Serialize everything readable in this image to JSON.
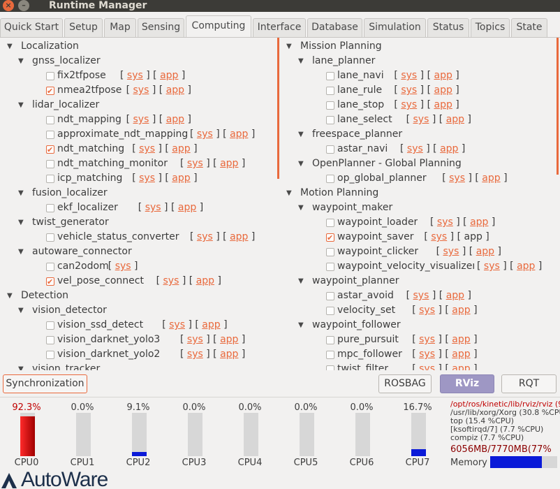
{
  "window": {
    "title": "Runtime Manager"
  },
  "tabs": [
    "Quick Start",
    "Setup",
    "Map",
    "Sensing",
    "Computing",
    "Interface",
    "Database",
    "Simulation",
    "Status",
    "Topics",
    "State"
  ],
  "active_tab": "Computing",
  "left_tree": [
    {
      "type": "group",
      "level": 0,
      "label": "Localization"
    },
    {
      "type": "group",
      "level": 1,
      "label": "gnss_localizer"
    },
    {
      "type": "node",
      "label": "fix2tfpose",
      "checked": false
    },
    {
      "type": "node",
      "label": "nmea2tfpose",
      "checked": true
    },
    {
      "type": "group",
      "level": 1,
      "label": "lidar_localizer"
    },
    {
      "type": "node",
      "label": "ndt_mapping",
      "checked": false
    },
    {
      "type": "node",
      "label": "approximate_ndt_mapping",
      "checked": false
    },
    {
      "type": "node",
      "label": "ndt_matching",
      "checked": true
    },
    {
      "type": "node",
      "label": "ndt_matching_monitor",
      "checked": false
    },
    {
      "type": "node",
      "label": "icp_matching",
      "checked": false
    },
    {
      "type": "group",
      "level": 1,
      "label": "fusion_localizer"
    },
    {
      "type": "node",
      "label": "ekf_localizer",
      "checked": false
    },
    {
      "type": "group",
      "level": 1,
      "label": "twist_generator"
    },
    {
      "type": "node",
      "label": "vehicle_status_converter",
      "checked": false
    },
    {
      "type": "group",
      "level": 1,
      "label": "autoware_connector"
    },
    {
      "type": "node",
      "label": "can2odom",
      "checked": false,
      "app": false
    },
    {
      "type": "node",
      "label": "vel_pose_connect",
      "checked": true
    },
    {
      "type": "group",
      "level": 0,
      "label": "Detection"
    },
    {
      "type": "group",
      "level": 1,
      "label": "vision_detector"
    },
    {
      "type": "node",
      "label": "vision_ssd_detect",
      "checked": false
    },
    {
      "type": "node",
      "label": "vision_darknet_yolo3",
      "checked": false
    },
    {
      "type": "node",
      "label": "vision_darknet_yolo2",
      "checked": false
    },
    {
      "type": "group",
      "level": 1,
      "label": "vision_tracker"
    }
  ],
  "right_tree": [
    {
      "type": "group",
      "level": 0,
      "label": "Mission Planning"
    },
    {
      "type": "group",
      "level": 1,
      "label": "lane_planner"
    },
    {
      "type": "node",
      "label": "lane_navi",
      "checked": false
    },
    {
      "type": "node",
      "label": "lane_rule",
      "checked": false
    },
    {
      "type": "node",
      "label": "lane_stop",
      "checked": false
    },
    {
      "type": "node",
      "label": "lane_select",
      "checked": false
    },
    {
      "type": "group",
      "level": 1,
      "label": "freespace_planner"
    },
    {
      "type": "node",
      "label": "astar_navi",
      "checked": false
    },
    {
      "type": "group",
      "level": 1,
      "label": "OpenPlanner - Global Planning"
    },
    {
      "type": "node",
      "label": "op_global_planner",
      "checked": false
    },
    {
      "type": "group",
      "level": 0,
      "label": "Motion Planning"
    },
    {
      "type": "group",
      "level": 1,
      "label": "waypoint_maker"
    },
    {
      "type": "node",
      "label": "waypoint_loader",
      "checked": false
    },
    {
      "type": "node",
      "label": "waypoint_saver",
      "checked": true,
      "app_plain": true
    },
    {
      "type": "node",
      "label": "waypoint_clicker",
      "checked": false
    },
    {
      "type": "node",
      "label": "waypoint_velocity_visualizer",
      "checked": false
    },
    {
      "type": "group",
      "level": 1,
      "label": "waypoint_planner"
    },
    {
      "type": "node",
      "label": "astar_avoid",
      "checked": false
    },
    {
      "type": "node",
      "label": "velocity_set",
      "checked": false
    },
    {
      "type": "group",
      "level": 1,
      "label": "waypoint_follower"
    },
    {
      "type": "node",
      "label": "pure_pursuit",
      "checked": false
    },
    {
      "type": "node",
      "label": "mpc_follower",
      "checked": false
    },
    {
      "type": "node",
      "label": "twist_filter",
      "checked": false
    }
  ],
  "link_labels": {
    "sys": "sys",
    "app": "app",
    "open": "[",
    "close": "]"
  },
  "buttons": {
    "synchronization": "Synchronization",
    "rosbag": "ROSBAG",
    "rviz": "RViz",
    "rqt": "RQT"
  },
  "cpus": [
    {
      "name": "CPU0",
      "percent_text": "92.3%",
      "usage": 92.3,
      "highlight": true
    },
    {
      "name": "CPU1",
      "percent_text": "0.0%",
      "usage": 0.0,
      "highlight": false
    },
    {
      "name": "CPU2",
      "percent_text": "9.1%",
      "usage": 9.1,
      "highlight": false
    },
    {
      "name": "CPU3",
      "percent_text": "0.0%",
      "usage": 0.0,
      "highlight": false
    },
    {
      "name": "CPU4",
      "percent_text": "0.0%",
      "usage": 0.0,
      "highlight": false
    },
    {
      "name": "CPU5",
      "percent_text": "0.0%",
      "usage": 0.0,
      "highlight": false
    },
    {
      "name": "CPU6",
      "percent_text": "0.0%",
      "usage": 0.0,
      "highlight": false
    },
    {
      "name": "CPU7",
      "percent_text": "16.7%",
      "usage": 16.7,
      "highlight": false
    }
  ],
  "processes": [
    {
      "text": "/opt/ros/kinetic/lib/rviz/rviz (92.",
      "highlight": true
    },
    {
      "text": "/usr/lib/xorg/Xorg (30.8 %CPU)",
      "highlight": false
    },
    {
      "text": "top (15.4 %CPU)",
      "highlight": false
    },
    {
      "text": "[ksoftirqd/7] (7.7 %CPU)",
      "highlight": false
    },
    {
      "text": "compiz (7.7 %CPU)",
      "highlight": false
    }
  ],
  "memory": {
    "text": "6056MB/7770MB(77%",
    "label": "Memory",
    "usage": 77
  },
  "logo": {
    "text": "AutoWare"
  },
  "colors": {
    "accent": "#e9693c",
    "cpu_high": "#c00000",
    "cpu_low": "#0a1ad8",
    "memory": "#0a1ad8"
  }
}
